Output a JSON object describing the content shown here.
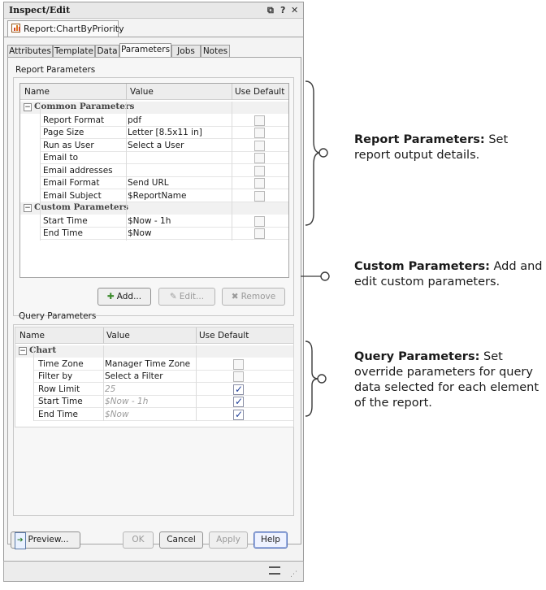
{
  "window": {
    "title": "Inspect/Edit",
    "controls": [
      "⧉",
      "?",
      "✕"
    ]
  },
  "report_tab": {
    "label": "Report:ChartByPriority"
  },
  "tabs": [
    {
      "label": "Attributes",
      "active": false
    },
    {
      "label": "Template",
      "active": false
    },
    {
      "label": "Data",
      "active": false
    },
    {
      "label": "Parameters",
      "active": true
    },
    {
      "label": "Jobs",
      "active": false
    },
    {
      "label": "Notes",
      "active": false
    }
  ],
  "report_parameters": {
    "group_label": "Report Parameters",
    "columns": [
      "Name",
      "Value",
      "Use Default"
    ],
    "common_category": "Common Parameters",
    "common_rows": [
      {
        "name": "Report Format",
        "value": "pdf",
        "default": false
      },
      {
        "name": "Page Size",
        "value": "Letter [8.5x11 in]",
        "default": false
      },
      {
        "name": "Run as User",
        "value": "Select a User",
        "default": false
      },
      {
        "name": "Email to",
        "value": "",
        "default": false
      },
      {
        "name": "Email addresses",
        "value": "",
        "default": false
      },
      {
        "name": "Email Format",
        "value": "Send URL",
        "default": false
      },
      {
        "name": "Email Subject",
        "value": "$ReportName",
        "default": false
      }
    ],
    "custom_category": "Custom Parameters",
    "custom_rows": [
      {
        "name": "Start Time",
        "value": "$Now - 1h",
        "default": false
      },
      {
        "name": "End Time",
        "value": "$Now",
        "default": false
      }
    ]
  },
  "buttons_row": {
    "add": "Add...",
    "edit": "Edit...",
    "remove": "Remove"
  },
  "query_parameters": {
    "group_label": "Query Parameters",
    "columns": [
      "Name",
      "Value",
      "Use Default"
    ],
    "category": "Chart",
    "rows": [
      {
        "name": "Time Zone",
        "value": "Manager Time Zone",
        "default": false,
        "dim": false
      },
      {
        "name": "Filter by",
        "value": "Select a Filter",
        "default": false,
        "dim": false
      },
      {
        "name": "Row Limit",
        "value": "25",
        "default": true,
        "dim": true
      },
      {
        "name": "Start Time",
        "value": "$Now - 1h",
        "default": true,
        "dim": true
      },
      {
        "name": "End Time",
        "value": "$Now",
        "default": true,
        "dim": true
      }
    ]
  },
  "footer": {
    "preview": "Preview...",
    "ok": "OK",
    "cancel": "Cancel",
    "apply": "Apply",
    "help": "Help"
  },
  "callouts": [
    {
      "title": "Report Parameters:",
      "text": "Set report output details."
    },
    {
      "title": "Custom Parameters:",
      "text": "Add and edit custom parameters."
    },
    {
      "title": "Query Parameters:",
      "text": "Set override parameters for query data selected for each element of the report."
    }
  ]
}
